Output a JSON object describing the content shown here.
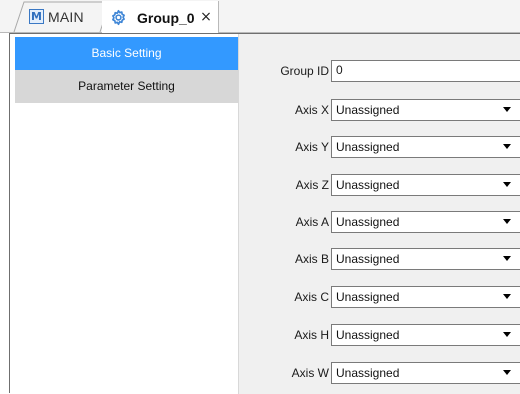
{
  "tabs": {
    "main": {
      "label": "MAIN",
      "icon": "m-document-icon",
      "icon_glyph": "M"
    },
    "group": {
      "label": "Group_0",
      "icon": "gear-icon",
      "close_glyph": "×"
    }
  },
  "sidebar": {
    "items": [
      {
        "label": "Basic Setting",
        "selected": true
      },
      {
        "label": "Parameter Setting",
        "selected": false
      }
    ]
  },
  "form": {
    "group_id": {
      "label": "Group ID",
      "value": "0"
    },
    "axes": [
      {
        "label": "Axis X",
        "value": "Unassigned"
      },
      {
        "label": "Axis Y",
        "value": "Unassigned"
      },
      {
        "label": "Axis Z",
        "value": "Unassigned"
      },
      {
        "label": "Axis A",
        "value": "Unassigned"
      },
      {
        "label": "Axis B",
        "value": "Unassigned"
      },
      {
        "label": "Axis C",
        "value": "Unassigned"
      },
      {
        "label": "Axis H",
        "value": "Unassigned"
      },
      {
        "label": "Axis W",
        "value": "Unassigned"
      }
    ]
  },
  "colors": {
    "selected_nav": "#3399ff",
    "unselected_nav": "#d7d7d7",
    "panel_bg": "#f0f0f0"
  }
}
